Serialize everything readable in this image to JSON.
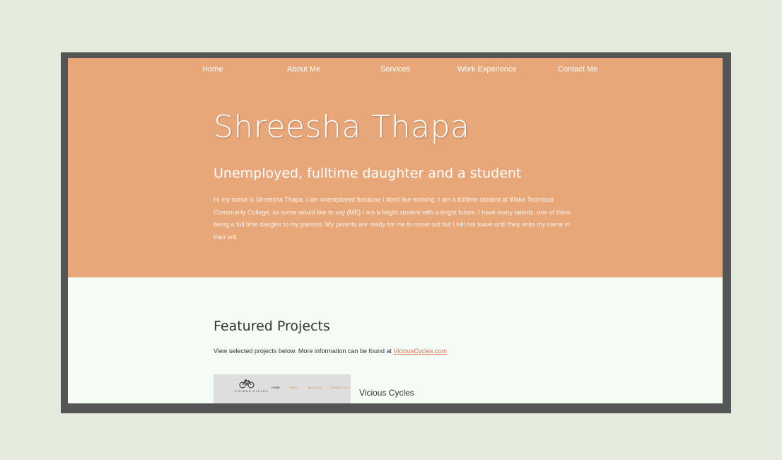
{
  "colors": {
    "page_background": "#e5ebdc",
    "frame": "#555555",
    "hero_background": "#e8a779",
    "content_background": "#f5fcf6",
    "link": "#e06a4a"
  },
  "nav": {
    "items": [
      {
        "label": "Home"
      },
      {
        "label": "About Me"
      },
      {
        "label": "Services"
      },
      {
        "label": "Work Experience"
      },
      {
        "label": "Contact Me"
      }
    ]
  },
  "hero": {
    "title": "Shreesha Thapa",
    "subtitle": "Unemployed, fulltime daughter and a student",
    "bio": "Hi my name is Shreesha Thapa. I am unemployed because I don't like working. I am a fulltime student at Wake Technical Community College, as some would like to say (ME) I am a bright student with a bright future. I have many talents, one of them being a full time daugter to my parents. My parents are ready for me to move out but I will not leave until they write my name in their will."
  },
  "featured": {
    "title": "Featured Projects",
    "description": "View selected projects below. More information can be found at ",
    "link_text": "ViciousCycles.com",
    "projects": [
      {
        "name": "Vicious Cycles",
        "thumbnail": {
          "logo_text": "VICIOUS CYCLES",
          "logo_icon": "bicycle-icon",
          "nav": [
            "HOME",
            "SHOP",
            "ABOUT US",
            "CONTACT US"
          ]
        }
      }
    ]
  }
}
